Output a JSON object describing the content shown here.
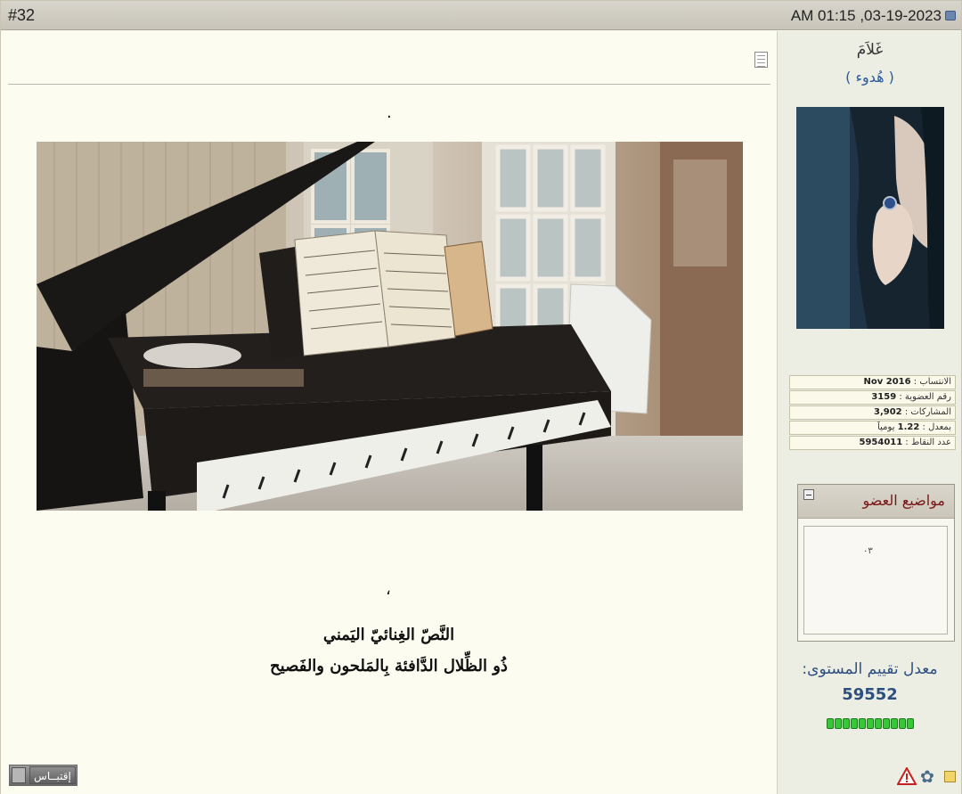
{
  "post": {
    "number": "#32",
    "date": "03-19-2023, 01:15 AM",
    "date_display": "AM 01:15 ,03-19-2023"
  },
  "content": {
    "dot": ".",
    "comma": "،",
    "line1": "النَّصّ الغِنائيّ اليَمني",
    "line2": "ذُو الظِّلال الدَّافئة بِالمَلحون والفَصيح"
  },
  "quote_button": {
    "label": "إقتبــاس"
  },
  "user": {
    "name": "غَلاَمَ",
    "title": "( هُدوء )",
    "info": [
      {
        "label": "الانتساب :",
        "value": "Nov 2016"
      },
      {
        "label": "رقم العضوية :",
        "value": "3159"
      },
      {
        "label": "المشاركات :",
        "value": "3,902"
      },
      {
        "label": "بمعدل :",
        "value": "1.22",
        "suffix": "يومياً"
      },
      {
        "label": "عدد النقاط :",
        "value": "5954011"
      }
    ]
  },
  "member_topics": {
    "title": "مواضيع العضو",
    "placeholder": "٠٣"
  },
  "level": {
    "label": "معدل تقييم المستوى:",
    "value": "59552",
    "bars": 11,
    "bar_color": "#36c836"
  },
  "colors": {
    "header_bg": "#d0cdc3",
    "content_bg": "#fdfcf1",
    "sidebar_bg": "#eceee4",
    "link_blue": "#2d5a9a",
    "topics_title": "#7a1515"
  },
  "icons": [
    "doc-icon",
    "calendar-icon",
    "warning-icon",
    "gear-icon",
    "reputation-icon",
    "collapse-icon"
  ]
}
